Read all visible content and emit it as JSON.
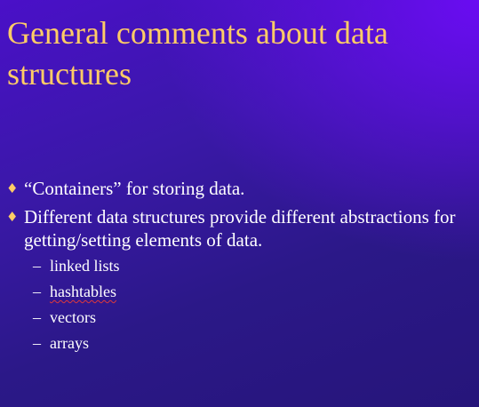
{
  "slide": {
    "title": "General comments about data structures",
    "bullets": [
      {
        "text": "“Containers” for storing data."
      },
      {
        "text": "Different data structures provide different abstractions for getting/setting elements of data."
      }
    ],
    "subitems": [
      {
        "text": "linked lists"
      },
      {
        "text": "hashtables"
      },
      {
        "text": "vectors"
      },
      {
        "text": "arrays"
      }
    ],
    "bullet_marker": "♦",
    "subitem_marker": "–"
  },
  "colors": {
    "title": "#ffcc66",
    "body_text": "#ffffff",
    "background_top": "#6a0cf2",
    "background_bottom": "#26157a",
    "spellcheck_underline": "#e0383a"
  }
}
